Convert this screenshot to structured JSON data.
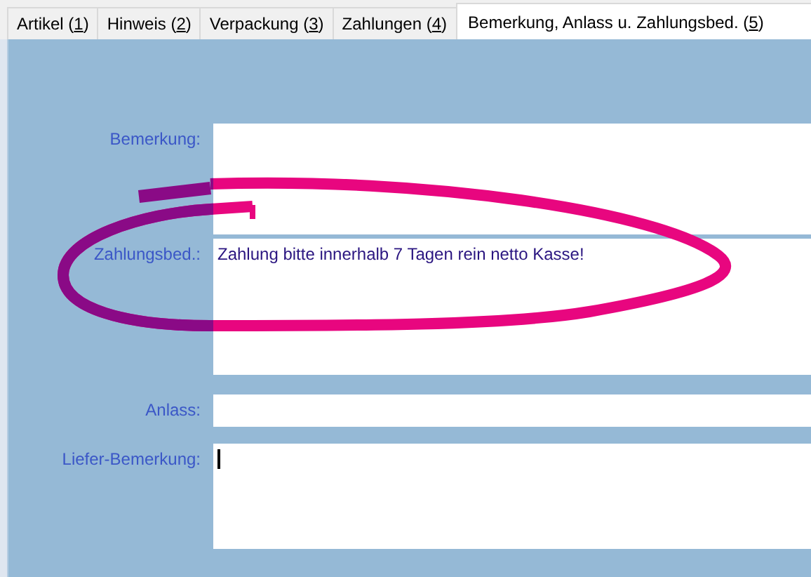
{
  "tabs": [
    {
      "text_before": "Artikel (",
      "shortcut": "1",
      "text_after": ")",
      "selected": false
    },
    {
      "text_before": "Hinweis (",
      "shortcut": "2",
      "text_after": ")",
      "selected": false
    },
    {
      "text_before": "Verpackung (",
      "shortcut": "3",
      "text_after": ")",
      "selected": false
    },
    {
      "text_before": "Zahlungen (",
      "shortcut": "4",
      "text_after": ")",
      "selected": false
    },
    {
      "text_before": "Bemerkung, Anlass u. Zahlungsbed. (",
      "shortcut": "5",
      "text_after": ")",
      "selected": true
    }
  ],
  "fields": [
    {
      "label": "Bemerkung:",
      "kind": "multiline",
      "focused": false
    },
    {
      "label": "Zahlungsbed.:",
      "kind": "multiline",
      "value": "Zahlung bitte innerhalb 7 Tagen rein netto Kasse!",
      "focused": false
    },
    {
      "label": "Anlass:",
      "kind": "single",
      "focused": false
    },
    {
      "label": "Liefer-Bemerkung:",
      "kind": "multiline",
      "focused": true
    }
  ]
}
